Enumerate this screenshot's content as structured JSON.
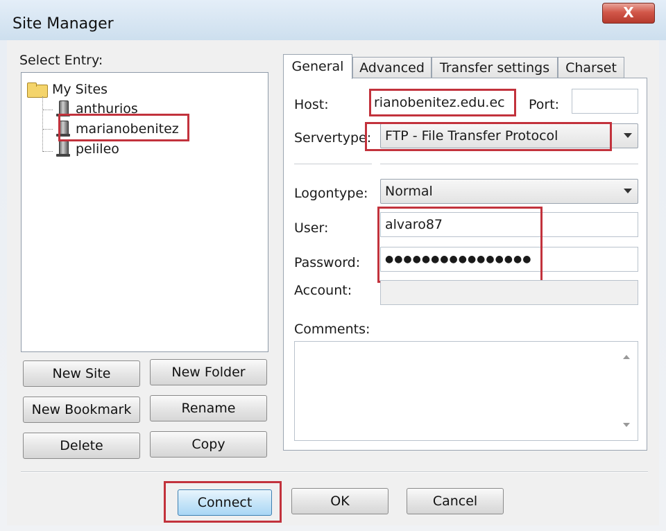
{
  "window": {
    "title": "Site Manager",
    "close_label": "X"
  },
  "tree": {
    "label": "Select Entry:",
    "root": "My Sites",
    "sites": [
      "anthurios",
      "marianobenitez",
      "pelileo"
    ]
  },
  "buttons": {
    "new_site": "New Site",
    "new_folder": "New Folder",
    "new_bookmark": "New Bookmark",
    "rename": "Rename",
    "delete": "Delete",
    "copy": "Copy",
    "connect": "Connect",
    "ok": "OK",
    "cancel": "Cancel"
  },
  "tabs": [
    "General",
    "Advanced",
    "Transfer settings",
    "Charset"
  ],
  "general": {
    "host_label": "Host:",
    "host_value": "rianobenitez.edu.ec",
    "port_label": "Port:",
    "port_value": "",
    "servertype_label": "Servertype:",
    "servertype_value": "FTP - File Transfer Protocol",
    "logontype_label": "Logontype:",
    "logontype_value": "Normal",
    "user_label": "User:",
    "user_value": "alvaro87",
    "password_label": "Password:",
    "password_value": "●●●●●●●●●●●●●●●●",
    "account_label": "Account:",
    "account_value": "",
    "comments_label": "Comments:",
    "comments_value": ""
  },
  "colors": {
    "highlight": "#c2323c",
    "default_button": "#a9d6f5"
  }
}
